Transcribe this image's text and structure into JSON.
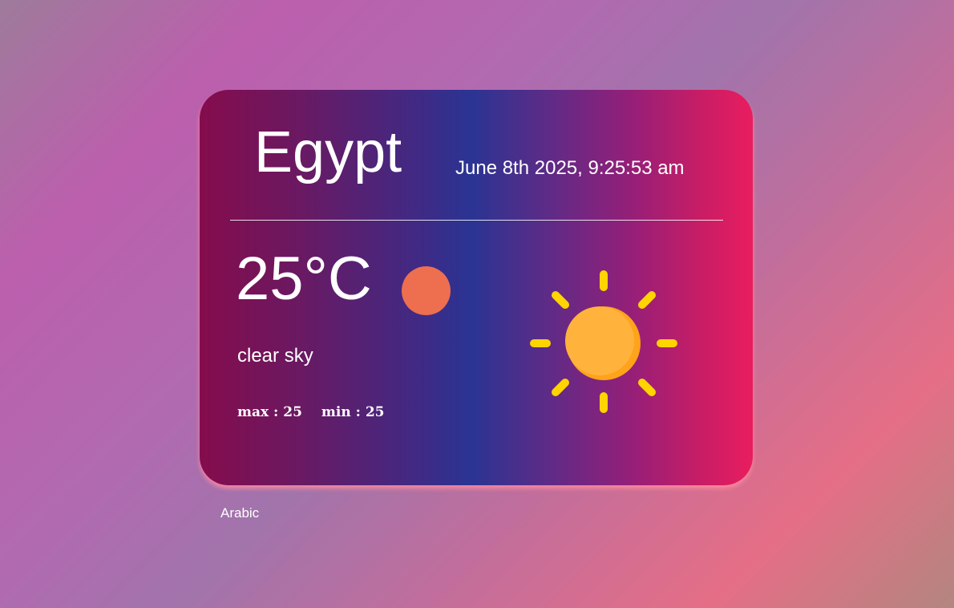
{
  "weather": {
    "city": "Egypt",
    "datetime": "June 8th 2025, 9:25:53 am",
    "temperature": "25°C",
    "description": "clear sky",
    "max_label": "max : 25",
    "min_label": "min : 25",
    "icon": "sun-icon"
  },
  "footer": {
    "language_link": "Arabic"
  },
  "colors": {
    "orb": "#ed6f50",
    "sun_body": "#ffb33d",
    "sun_rays": "#ffd400"
  }
}
